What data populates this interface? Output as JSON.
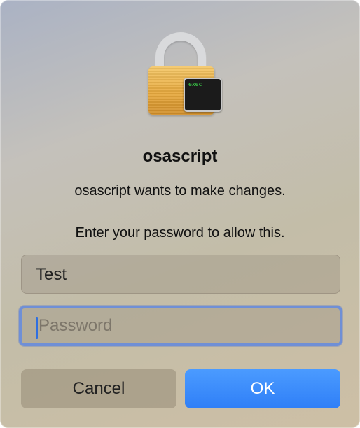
{
  "dialog": {
    "title": "osascript",
    "message": "osascript wants to make changes.",
    "prompt": "Enter your password to allow this."
  },
  "icon": {
    "name": "lock-icon",
    "badge_name": "terminal-icon",
    "badge_text": "exec"
  },
  "fields": {
    "username_value": "Test",
    "password_placeholder": "Password"
  },
  "buttons": {
    "cancel_label": "Cancel",
    "ok_label": "OK"
  },
  "colors": {
    "accent": "#2f7ff7",
    "focus_ring": "#6f8fd6",
    "lock_gold": "#e7a93e"
  }
}
